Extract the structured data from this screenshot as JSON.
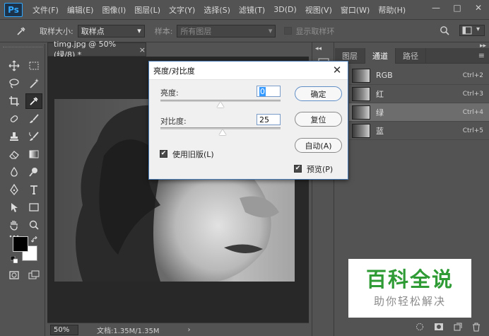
{
  "app": {
    "logo": "Ps"
  },
  "menu": [
    "文件(F)",
    "编辑(E)",
    "图像(I)",
    "图层(L)",
    "文字(Y)",
    "选择(S)",
    "滤镜(T)",
    "3D(D)",
    "视图(V)",
    "窗口(W)",
    "帮助(H)"
  ],
  "window_controls": {
    "minimize": "—",
    "maximize": "□",
    "close": "✕"
  },
  "options": {
    "sample_size_label": "取样大小:",
    "sample_size_value": "取样点",
    "sample_label": "样本:",
    "sample_value": "所有图层",
    "show_ring_label": "显示取样环"
  },
  "document": {
    "tab_title": "timg.jpg @ 50%(绿/8) *",
    "tab_close": "×",
    "zoom": "50%",
    "doc_info": "文档:1.35M/1.35M",
    "doc_info_arrow": "›"
  },
  "panel": {
    "tabs": [
      "图层",
      "通道",
      "路径"
    ],
    "active_tab": "通道",
    "channels": [
      {
        "name": "RGB",
        "shortcut": "Ctrl+2",
        "selected": false
      },
      {
        "name": "红",
        "shortcut": "Ctrl+3",
        "selected": false
      },
      {
        "name": "绿",
        "shortcut": "Ctrl+4",
        "selected": true
      },
      {
        "name": "蓝",
        "shortcut": "Ctrl+5",
        "selected": false
      }
    ]
  },
  "dialog": {
    "title": "亮度/对比度",
    "close": "✕",
    "brightness_label": "亮度:",
    "brightness_value": "0",
    "contrast_label": "对比度:",
    "contrast_value": "25",
    "ok_label": "确定",
    "reset_label": "复位",
    "auto_label": "自动(A)",
    "legacy_label": "使用旧版(L)",
    "legacy_checked": true,
    "preview_label": "预览(P)",
    "preview_checked": true,
    "brightness_slider": 0.5,
    "contrast_slider": 0.52
  },
  "watermark": {
    "main": "百科全说",
    "sub": "助你轻松解决"
  },
  "colors": {
    "accent": "#31a8ff",
    "watermark_green": "#2e9b35",
    "dialog_border": "#4a7cb8"
  }
}
